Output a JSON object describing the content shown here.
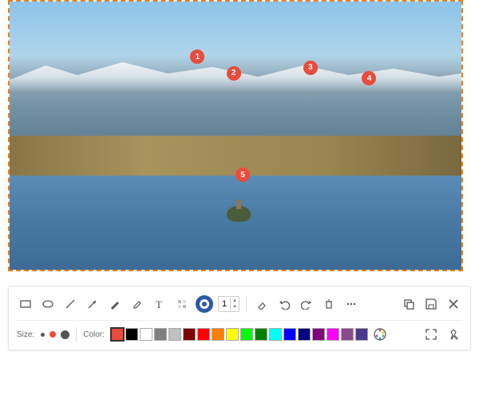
{
  "markers": [
    "1",
    "2",
    "3",
    "4",
    "5"
  ],
  "spinner_value": "1",
  "size_label": "Size:",
  "color_label": "Color:",
  "colors": [
    "#e74c3c",
    "#000000",
    "#ffffff",
    "#7f7f7f",
    "#c0c0c0",
    "#7b0000",
    "#ff0000",
    "#ff7f00",
    "#ffff00",
    "#00ff00",
    "#008000",
    "#00ffff",
    "#0000ff",
    "#000080",
    "#800080",
    "#ff00ff",
    "#8b4a8b",
    "#4b3a8b"
  ],
  "selected_color_index": 0,
  "selected_size_index": 1
}
